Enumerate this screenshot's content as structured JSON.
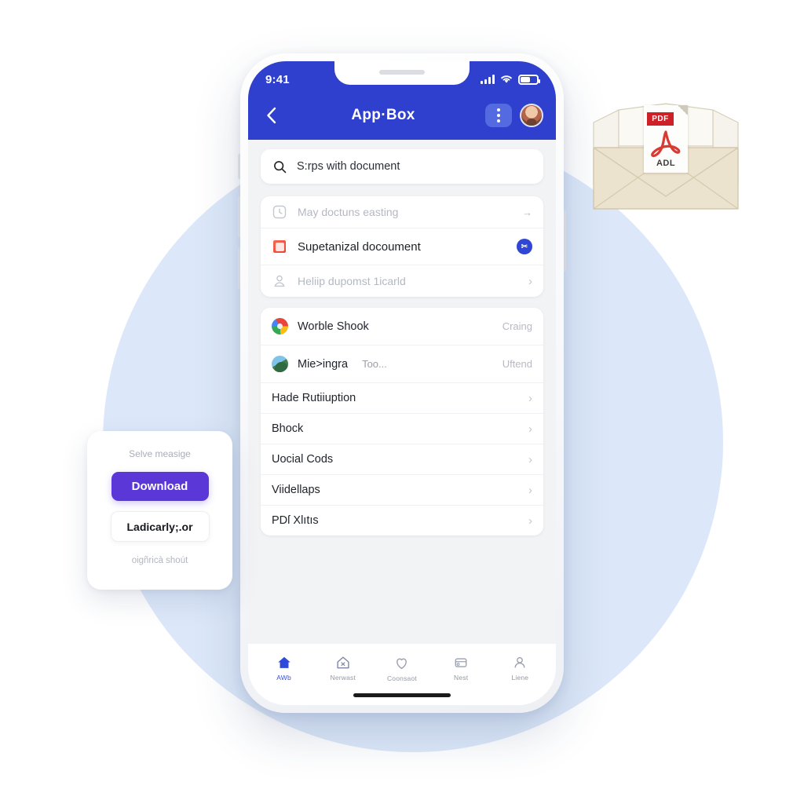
{
  "app": {
    "status_bar": {
      "time": "9:41",
      "signal_icon": "cellular-bars-icon",
      "wifi_icon": "wifi-icon",
      "battery_icon": "battery-icon"
    },
    "appbar": {
      "back_icon": "chevron-left-icon",
      "title": "App·Box",
      "menu_icon": "kebab-menu-icon",
      "avatar_icon": "avatar"
    },
    "search": {
      "icon": "search-icon",
      "value": "S:rps with document"
    },
    "suggestions": [
      {
        "icon": "history-clock-icon",
        "label": "May doctuns easting",
        "trailing": "→",
        "trailing_type": "arrow"
      },
      {
        "icon": "document-app-icon",
        "label": "Supetanizal docoument",
        "trailing": "✂",
        "trailing_type": "badge"
      },
      {
        "icon": "person-download-icon",
        "label": "Heliip dupomst 1icarld",
        "trailing": "›",
        "trailing_type": "chevron"
      }
    ],
    "list": [
      {
        "icon": "chrome-circle-icon",
        "title": "Worble Shook",
        "sub": "",
        "meta": "Craing",
        "chevron": ""
      },
      {
        "icon": "photos-circle-icon",
        "title": "Mie>ingra",
        "sub": "Too...",
        "meta": "Uftend",
        "chevron": ""
      },
      {
        "icon": "",
        "title": "Hade Rutiiuption",
        "sub": "",
        "meta": "",
        "chevron": "›"
      },
      {
        "icon": "",
        "title": "Bhock",
        "sub": "",
        "meta": "",
        "chevron": "›"
      },
      {
        "icon": "",
        "title": "Uocial Cods",
        "sub": "",
        "meta": "",
        "chevron": "›"
      },
      {
        "icon": "",
        "title": "Viidellaps",
        "sub": "",
        "meta": "",
        "chevron": "›"
      },
      {
        "icon": "",
        "title": "PDſ Xlıtıs",
        "sub": "",
        "meta": "",
        "chevron": "›"
      }
    ],
    "tabs": [
      {
        "icon": "home-icon",
        "label": "AWb",
        "active": true
      },
      {
        "icon": "store-icon",
        "label": "Nerwast",
        "active": false
      },
      {
        "icon": "heart-icon",
        "label": "Coonsaot",
        "active": false
      },
      {
        "icon": "wallet-icon",
        "label": "Nest",
        "active": false
      },
      {
        "icon": "person-icon",
        "label": "Liene",
        "active": false
      }
    ]
  },
  "download_card": {
    "top_text": "Selve measige",
    "primary_label": "Download",
    "secondary_label": "Ladicarly;.or",
    "bottom_text": "oigñricà shoút"
  },
  "envelope": {
    "pdf_tag": "PDF",
    "pdf_label": "ADL"
  },
  "colors": {
    "header_blue": "#2f40ce",
    "accent_purple": "#5b37d8",
    "badge_blue": "#2f47d4",
    "bg_circle": "#d9e6f8",
    "pdf_red": "#cf1f27"
  }
}
